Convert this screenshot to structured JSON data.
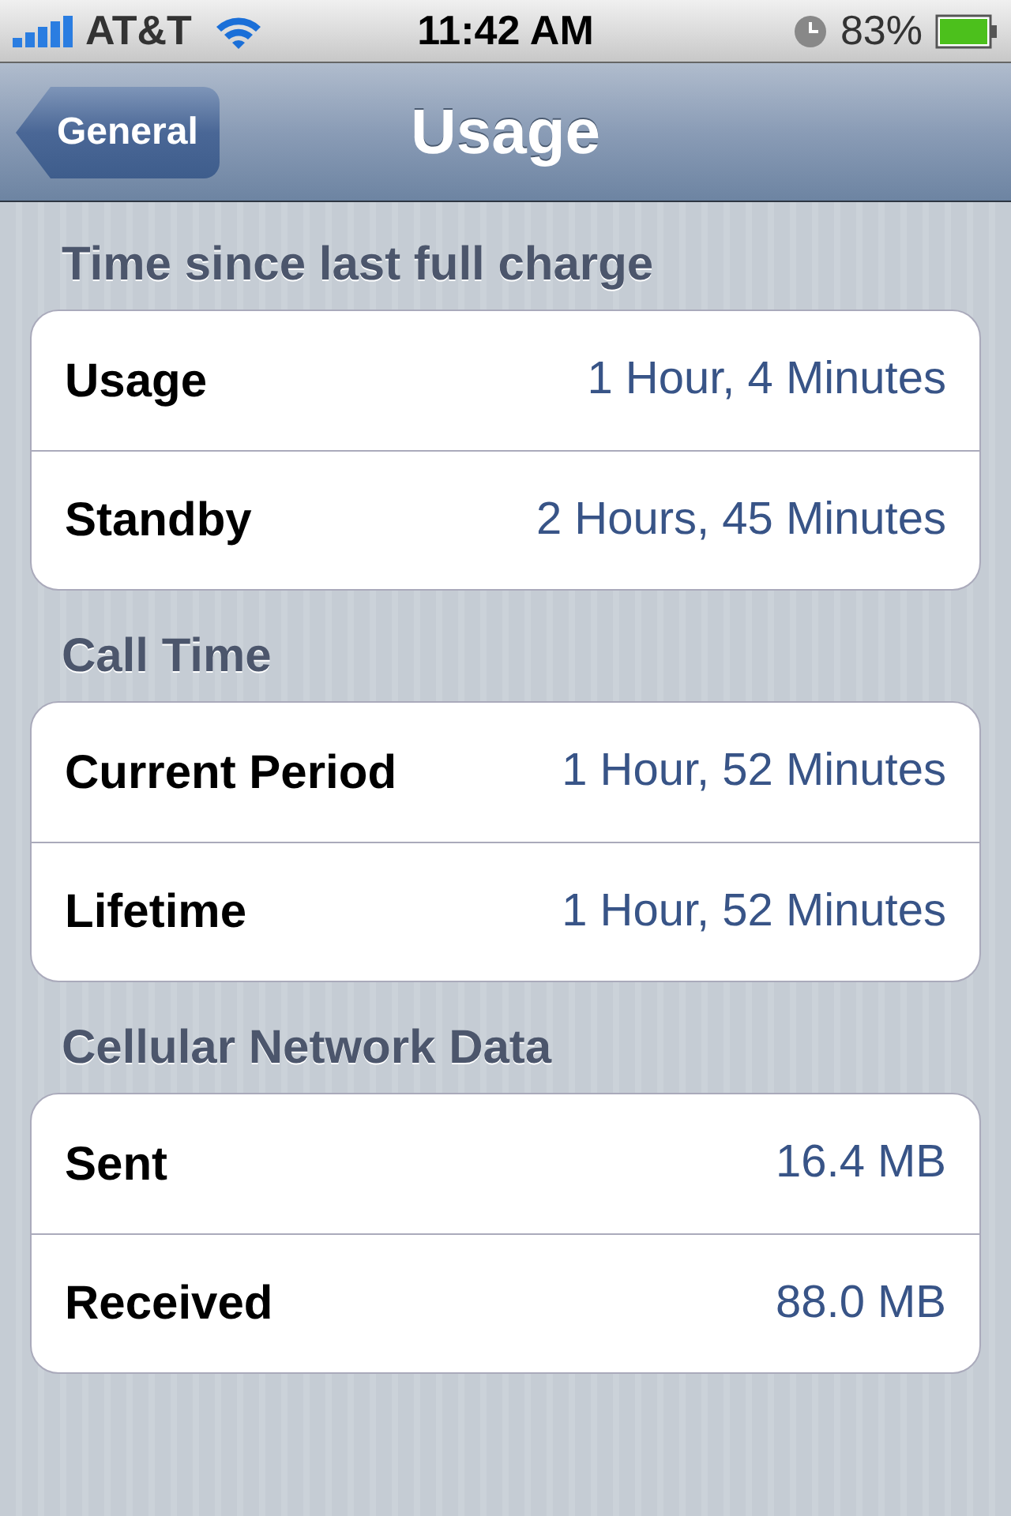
{
  "status_bar": {
    "carrier": "AT&T",
    "time": "11:42 AM",
    "battery": "83%"
  },
  "nav_bar": {
    "back_button": "General",
    "title": "Usage"
  },
  "sections": [
    {
      "header": "Time since last full charge",
      "rows": [
        {
          "label": "Usage",
          "value": "1 Hour, 4 Minutes"
        },
        {
          "label": "Standby",
          "value": "2 Hours, 45 Minutes"
        }
      ]
    },
    {
      "header": "Call Time",
      "rows": [
        {
          "label": "Current Period",
          "value": "1 Hour, 52 Minutes"
        },
        {
          "label": "Lifetime",
          "value": "1 Hour, 52 Minutes"
        }
      ]
    },
    {
      "header": "Cellular Network Data",
      "rows": [
        {
          "label": "Sent",
          "value": "16.4 MB"
        },
        {
          "label": "Received",
          "value": "88.0 MB"
        }
      ]
    }
  ]
}
